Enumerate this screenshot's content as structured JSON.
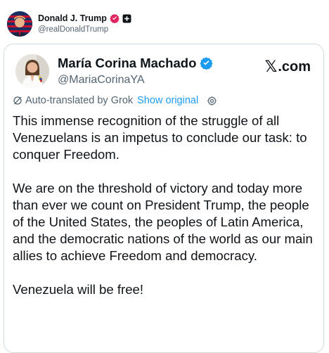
{
  "outer_post": {
    "display_name": "Donald J. Trump",
    "handle": "@realDonaldTrump"
  },
  "quoted_post": {
    "display_name": "María Corina Machado",
    "handle": "@MariaCorinaYA",
    "source_label": ".com",
    "translation_label": "Auto-translated by Grok",
    "show_original_label": "Show original",
    "paragraphs": [
      "This immense recognition of the struggle of all Venezuelans is an impetus to conclude our task: to conquer Freedom.",
      "We are on the threshold of victory and today more than ever we count on President Trump, the people of the United States, the peoples of Latin America, and the democratic nations of the world as our main allies to achieve Freedom and democracy.",
      "Venezuela will be free!"
    ]
  },
  "colors": {
    "verified_blue": "#1d9bf0",
    "affiliation_pink": "#e0245e",
    "muted_text": "#536471",
    "link_blue": "#1d9bf0"
  },
  "icons": {
    "outer_badges": [
      "pink-check-badge-icon",
      "government-affiliate-icon"
    ],
    "inner_badge": "verified-check-icon",
    "translation": "grok-slash-icon",
    "settings": "gear-icon",
    "brand": "x-logo-icon"
  }
}
